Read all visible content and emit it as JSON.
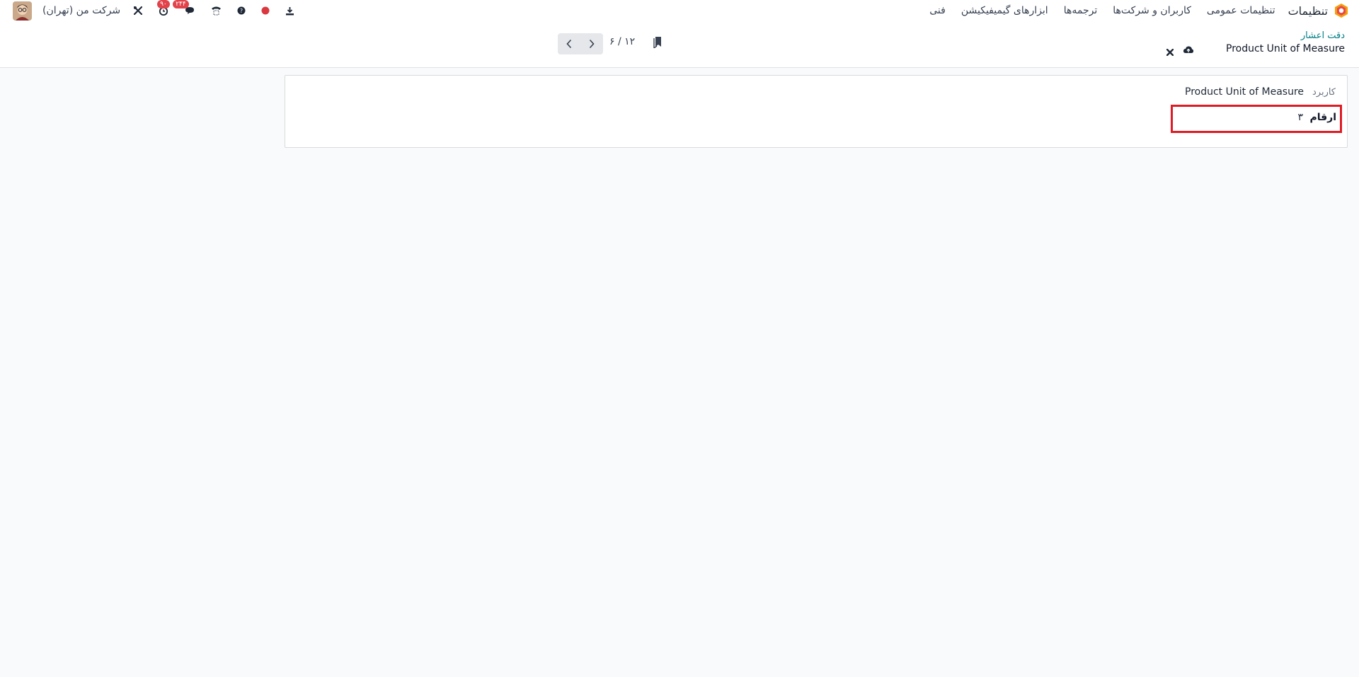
{
  "navbar": {
    "app_name": "تنظیمات",
    "menu": [
      "تنظیمات عمومی",
      "کاربران و شرکت‌ها",
      "ترجمه‌ها",
      "ابزارهای گیمیفیکیشن",
      "فنی"
    ],
    "company": "شرکت من (تهران)",
    "activity_badge": "۹۰",
    "messages_badge": "۲۴۴",
    "icons": [
      "download-icon",
      "record-dot-icon",
      "help-icon",
      "phone-icon",
      "chat-icon",
      "clock-icon",
      "tools-icon"
    ],
    "colors": {
      "badge": "#e2434b",
      "record_dot": "#d9383f"
    }
  },
  "control_panel": {
    "breadcrumb": "دقت اعشار",
    "record_title": "Product Unit of Measure",
    "pager_value": "۶ / ۱۲"
  },
  "form": {
    "usage_label": "کاربرد",
    "usage_value": "Product Unit of Measure",
    "digits_label": "ارقام",
    "digits_value": "۳",
    "highlight_color": "#e01b24"
  }
}
